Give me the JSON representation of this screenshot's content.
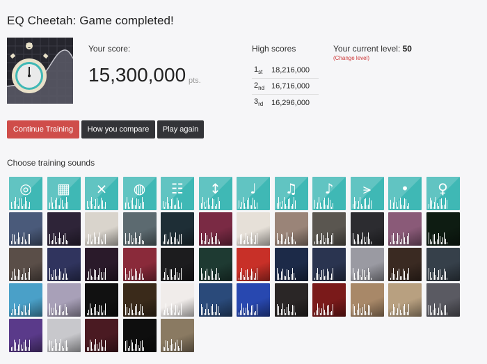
{
  "page_title": "EQ Cheetah: Game completed!",
  "game_icon": "stopwatch-icon",
  "score": {
    "label": "Your score:",
    "value": "15,300,000",
    "unit": "pts."
  },
  "high_scores": {
    "label": "High scores",
    "rows": [
      {
        "rank": "1",
        "suffix": "st",
        "score": "18,216,000"
      },
      {
        "rank": "2",
        "suffix": "nd",
        "score": "16,716,000"
      },
      {
        "rank": "3",
        "suffix": "rd",
        "score": "16,296,000"
      }
    ]
  },
  "level": {
    "label": "Your current level:",
    "value": "50",
    "change_link": "(Change level)"
  },
  "buttons": {
    "continue": "Continue Training",
    "compare": "How you compare",
    "play_again": "Play again"
  },
  "sounds_label": "Choose training sounds",
  "colors": {
    "accent_red": "#cf4d4a",
    "dark_button": "#333438",
    "instrument_teal": "#3fb8b5"
  },
  "sounds": {
    "instruments": [
      "dj-controller-icon",
      "drum-machine-icon",
      "drum-sticks-icon",
      "drum-kit-icon",
      "keyboard-icon",
      "electric-guitar-icon",
      "acoustic-guitar-icon",
      "piano-icon",
      "violin-icon",
      "trumpet-icon",
      "maracas-icon",
      "microphone-icon"
    ],
    "artists": [
      {
        "name": "artist-tile-1",
        "color": "#4a5a7a"
      },
      {
        "name": "artist-tile-2",
        "color": "#2e2438"
      },
      {
        "name": "artist-tile-3",
        "color": "#d9d4cc"
      },
      {
        "name": "artist-tile-4",
        "color": "#5c6a70"
      },
      {
        "name": "artist-tile-5",
        "color": "#1e2e36"
      },
      {
        "name": "artist-tile-6",
        "color": "#7a2a44"
      },
      {
        "name": "artist-tile-7",
        "color": "#e6e0d8"
      },
      {
        "name": "artist-tile-8",
        "color": "#9a8478"
      },
      {
        "name": "artist-tile-9",
        "color": "#5a5650"
      },
      {
        "name": "artist-tile-10",
        "color": "#2c2c30"
      },
      {
        "name": "artist-tile-11",
        "color": "#8a5a78"
      },
      {
        "name": "artist-tile-12",
        "color": "#0e1c12"
      },
      {
        "name": "artist-tile-13",
        "color": "#5a4e48"
      },
      {
        "name": "artist-tile-14",
        "color": "#30345e"
      },
      {
        "name": "artist-tile-15",
        "color": "#2a1a2a"
      },
      {
        "name": "artist-tile-16",
        "color": "#8a2a3a"
      },
      {
        "name": "artist-tile-17",
        "color": "#1c1c1e"
      },
      {
        "name": "artist-tile-18",
        "color": "#1e3a32"
      },
      {
        "name": "artist-tile-19",
        "color": "#c83028"
      },
      {
        "name": "artist-tile-20",
        "color": "#1c2a48"
      },
      {
        "name": "artist-tile-21",
        "color": "#2a3450"
      },
      {
        "name": "artist-tile-22",
        "color": "#9a9aa2"
      },
      {
        "name": "artist-tile-23",
        "color": "#3a2a22"
      },
      {
        "name": "artist-tile-24",
        "color": "#36404a"
      },
      {
        "name": "artist-tile-25",
        "color": "#4aa0c8"
      },
      {
        "name": "artist-tile-26",
        "color": "#a8a0b8"
      },
      {
        "name": "artist-tile-27",
        "color": "#111111"
      },
      {
        "name": "artist-tile-28",
        "color": "#3a2a1a"
      },
      {
        "name": "artist-tile-29",
        "color": "#f0ecea"
      },
      {
        "name": "artist-tile-30",
        "color": "#2a4a7a"
      },
      {
        "name": "artist-tile-31",
        "color": "#2848b0"
      },
      {
        "name": "artist-tile-32",
        "color": "#2a2626"
      },
      {
        "name": "artist-tile-33",
        "color": "#7a1a1a"
      },
      {
        "name": "artist-tile-34",
        "color": "#a88868"
      },
      {
        "name": "artist-tile-35",
        "color": "#b8a080"
      },
      {
        "name": "artist-tile-36",
        "color": "#5a5a62"
      },
      {
        "name": "artist-tile-37",
        "color": "#5a3a8a"
      },
      {
        "name": "artist-tile-38",
        "color": "#c8c8cc"
      },
      {
        "name": "artist-tile-39",
        "color": "#4a1a22"
      },
      {
        "name": "artist-tile-40",
        "color": "#0e0e0e"
      },
      {
        "name": "artist-tile-41",
        "color": "#8a7a62"
      }
    ]
  }
}
